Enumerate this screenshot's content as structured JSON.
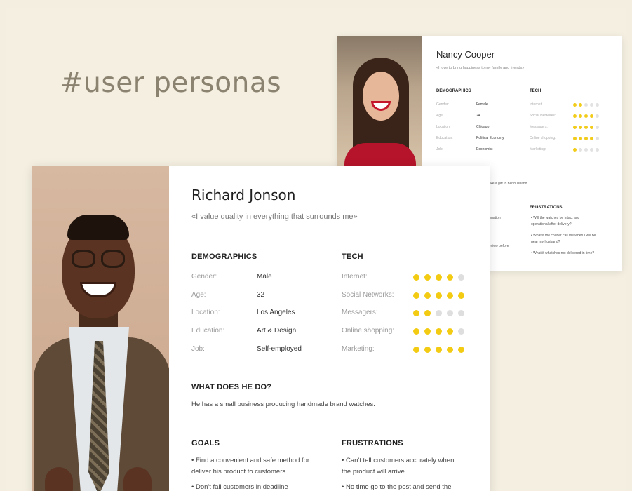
{
  "headline": "#user personas",
  "colors": {
    "accent_dot": "#f2cb12",
    "empty_dot": "#dedede",
    "background": "#f3eee0"
  },
  "back_persona": {
    "name": "Nancy Cooper",
    "quote": "«I love to bring happiness to my family and friends»",
    "demographics_title": "DEMOGRAPHICS",
    "tech_title": "TECH",
    "demographics": [
      {
        "label": "Gender:",
        "value": "Female"
      },
      {
        "label": "Age:",
        "value": "24"
      },
      {
        "label": "Location:",
        "value": "Chicago"
      },
      {
        "label": "Education:",
        "value": "Political Economy"
      },
      {
        "label": "Job:",
        "value": "Economist"
      }
    ],
    "tech": [
      {
        "label": "Internet:",
        "rating": 2
      },
      {
        "label": "Social Networks:",
        "rating": 4
      },
      {
        "label": "Messagers:",
        "rating": 4
      },
      {
        "label": "Online shopping:",
        "rating": 4
      },
      {
        "label": "Marketing:",
        "rating": 1
      }
    ],
    "partial_do_text": "like a gift to her husband.",
    "partial_goal_1": "rmation",
    "partial_goal_2": "eview before",
    "frustrations_title": "FRUSTRATIONS",
    "frustrations": [
      "• Will the watches be intact and",
      "  operational after delivery?",
      "• What if the courier call me when I will be",
      "  near my husband?",
      "• What if whatches not delivered in time?"
    ]
  },
  "front_persona": {
    "name": "Richard Jonson",
    "quote": "«I value quality in everything that surrounds me»",
    "demographics_title": "DEMOGRAPHICS",
    "tech_title": "TECH",
    "demographics": [
      {
        "label": "Gender:",
        "value": "Male"
      },
      {
        "label": "Age:",
        "value": "32"
      },
      {
        "label": "Location:",
        "value": "Los Angeles"
      },
      {
        "label": "Education:",
        "value": "Art & Design"
      },
      {
        "label": "Job:",
        "value": "Self-employed"
      }
    ],
    "tech": [
      {
        "label": "Internet:",
        "rating": 4
      },
      {
        "label": "Social Networks:",
        "rating": 5
      },
      {
        "label": "Messagers:",
        "rating": 2
      },
      {
        "label": "Online shopping:",
        "rating": 4
      },
      {
        "label": "Marketing:",
        "rating": 5
      }
    ],
    "what_title": "WHAT DOES HE DO?",
    "what_text": "He has a small business producing handmade brand watches.",
    "goals_title": "GOALS",
    "goals": [
      "• Find a convenient and safe method for",
      "  deliver his product to customers",
      "• Don't fail customers in deadline"
    ],
    "frustrations_title": "FRUSTRATIONS",
    "frustrations": [
      "• Can't tell customers accurately when",
      "  the product will arrive",
      "• No time go to the post and send the"
    ]
  }
}
